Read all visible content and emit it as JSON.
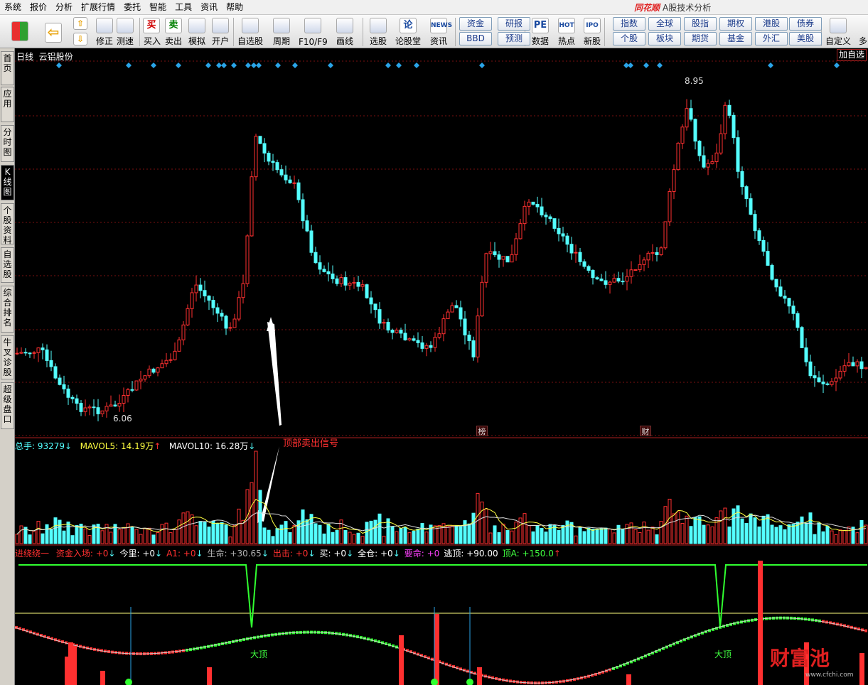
{
  "menu": {
    "items": [
      "系统",
      "报价",
      "分析",
      "扩展行情",
      "委托",
      "智能",
      "工具",
      "资讯",
      "帮助"
    ],
    "brand": "同花顺",
    "title": "A股技术分析"
  },
  "toolbar": {
    "buttons": [
      {
        "label": "修正",
        "icon": "refresh-icon"
      },
      {
        "label": "测速",
        "icon": "clock-icon"
      },
      {
        "label": "买入",
        "glyph": "买"
      },
      {
        "label": "卖出",
        "glyph": "卖"
      },
      {
        "label": "模拟",
        "icon": "hammer-icon"
      },
      {
        "label": "开户",
        "icon": "lock-icon"
      },
      {
        "label": "自选股",
        "icon": "star-icon"
      },
      {
        "label": "周期",
        "icon": "cycle-icon"
      },
      {
        "label": "F10/F9",
        "icon": "f10-icon"
      },
      {
        "label": "画线",
        "icon": "pen-icon"
      },
      {
        "label": "选股",
        "icon": "screen-icon"
      },
      {
        "label": "论股堂",
        "glyph": "论"
      },
      {
        "label": "资讯",
        "glyph": "NEWS"
      },
      {
        "label": "数据",
        "glyph": "PE"
      },
      {
        "label": "热点",
        "glyph": "HOT"
      },
      {
        "label": "新股",
        "glyph": "IPO"
      },
      {
        "label": "自定义",
        "icon": "edit-icon"
      },
      {
        "label": "多"
      }
    ],
    "quick": [
      "资金",
      "研报",
      "BBD",
      "预测",
      "指数",
      "全球",
      "股指",
      "期权",
      "港股",
      "债券",
      "个股",
      "板块",
      "期货",
      "基金",
      "外汇",
      "美股"
    ]
  },
  "sidebar": {
    "tabs": [
      {
        "label": "首页"
      },
      {
        "label": "应用"
      },
      {
        "label": "分时图"
      },
      {
        "label": "K线图"
      },
      {
        "label": "个股资料"
      },
      {
        "label": "自选股"
      },
      {
        "label": "综合排名"
      },
      {
        "label": "牛叉诊股"
      },
      {
        "label": "超级盘口"
      }
    ]
  },
  "chart": {
    "period": "日线",
    "stock": "云铝股份",
    "add_fav": "加自选",
    "max_label": "8.95",
    "min_label": "6.06",
    "tag1": "榜",
    "tag2": "财",
    "annotation": "顶部卖出信号",
    "volume_info": {
      "total": "总手: 93279",
      "mavol5": "MAVOL5: 14.19万",
      "mavol10": "MAVOL10: 16.28万"
    },
    "indicator": {
      "name": "进绕绕一",
      "items": [
        {
          "text": "资金入场: +0",
          "color": "#ff3030",
          "arrow": "↓"
        },
        {
          "text": "今里: +0",
          "color": "#ffffff",
          "arrow": "↓"
        },
        {
          "text": "A1: +0",
          "color": "#ff3030",
          "arrow": "↓"
        },
        {
          "text": "生命: +30.65",
          "color": "#b0b0b0",
          "arrow": "↓"
        },
        {
          "text": "出击: +0",
          "color": "#ff3030",
          "arrow": "↓"
        },
        {
          "text": "买: +0",
          "color": "#ffffff",
          "arrow": "↓"
        },
        {
          "text": "全仓: +0",
          "color": "#ffffff",
          "arrow": "↓"
        },
        {
          "text": "要命: +0",
          "color": "#ff40ff",
          "arrow": ""
        },
        {
          "text": "逃顶: +90.00",
          "color": "#ffffff",
          "arrow": ""
        },
        {
          "text": "顶A: +150.0",
          "color": "#40ff40",
          "arrow": "↑"
        }
      ],
      "label_top1": "大顶",
      "label_top2": "大顶"
    },
    "colors": {
      "up": "#ff3030",
      "down": "#54ffff",
      "grid": "#7a1010"
    }
  },
  "watermark": {
    "main": "财富池",
    "sub": "www.cfchi.com"
  }
}
